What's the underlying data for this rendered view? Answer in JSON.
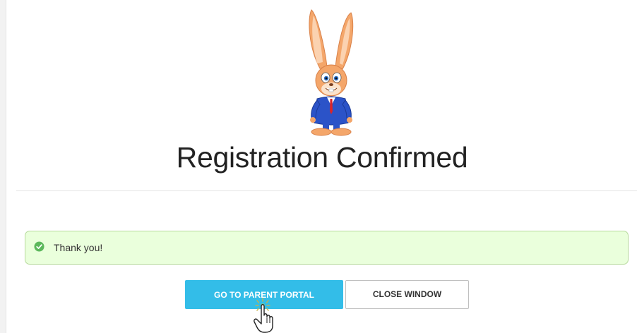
{
  "page": {
    "title": "Registration Confirmed"
  },
  "mascot": {
    "icon": "bunny-mascot-icon"
  },
  "alert": {
    "icon": "check-circle-icon",
    "message": "Thank you!",
    "color": "#eaffdc",
    "border_color": "#b6d99c",
    "icon_color": "#5cb85c"
  },
  "buttons": {
    "primary_label": "GO TO PARENT PORTAL",
    "secondary_label": "CLOSE WINDOW",
    "primary_color": "#33bde8"
  },
  "cursor": {
    "icon": "hand-pointer-icon"
  }
}
